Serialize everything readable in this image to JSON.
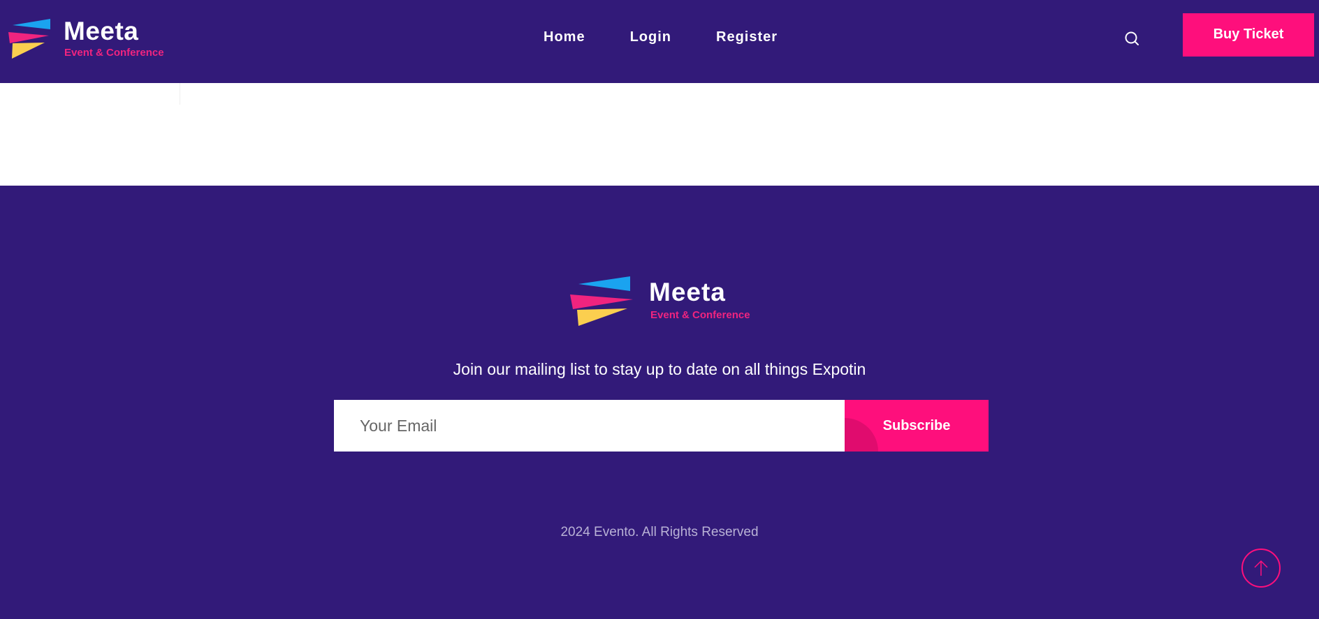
{
  "header": {
    "logo": {
      "brand": "Meeta",
      "tagline": "Event & Conference"
    },
    "nav": [
      {
        "label": "Home"
      },
      {
        "label": "Login"
      },
      {
        "label": "Register"
      }
    ],
    "search_icon": "search-icon",
    "buy_ticket_label": "Buy Ticket"
  },
  "footer": {
    "logo": {
      "brand": "Meeta",
      "tagline": "Event & Conference"
    },
    "mailing_text": "Join our mailing list to stay up to date on all things Expotin",
    "email_placeholder": "Your Email",
    "subscribe_label": "Subscribe",
    "copyright": "2024 Evento. All Rights Reserved",
    "scroll_top_icon": "arrow-up-icon"
  },
  "colors": {
    "primary_bg": "#321a79",
    "accent": "#fe0f7c",
    "logo_blue": "#1aa3f0",
    "logo_pink": "#f0247f",
    "logo_yellow": "#fbcf4f"
  }
}
